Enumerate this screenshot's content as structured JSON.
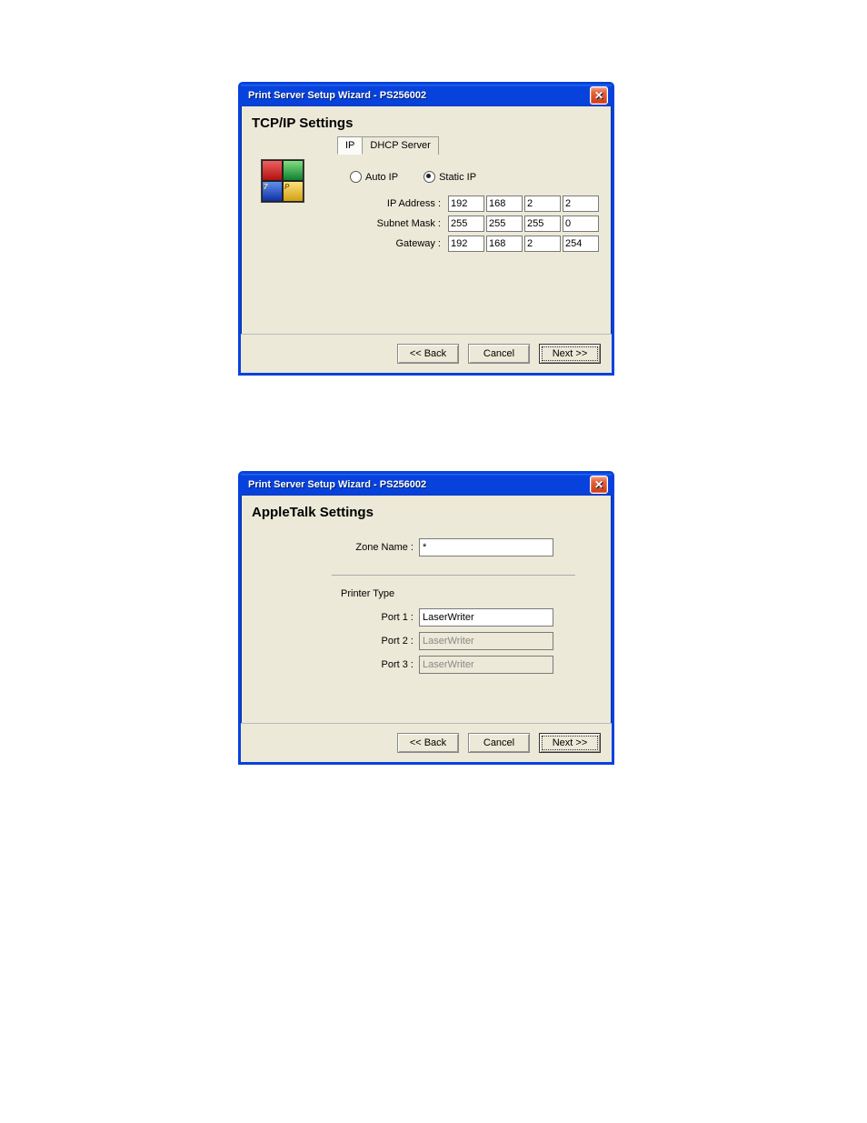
{
  "window1": {
    "title": "Print Server Setup Wizard - PS256002",
    "section_title": "TCP/IP Settings",
    "tabs": {
      "ip": "IP",
      "dhcp": "DHCP Server"
    },
    "radios": {
      "auto": "Auto IP",
      "static": "Static IP"
    },
    "fields": {
      "ip_label": "IP Address :",
      "subnet_label": "Subnet Mask :",
      "gateway_label": "Gateway :",
      "ip": [
        "192",
        "168",
        "2",
        "2"
      ],
      "subnet": [
        "255",
        "255",
        "255",
        "0"
      ],
      "gateway": [
        "192",
        "168",
        "2",
        "254"
      ]
    },
    "logo": {
      "blue_txt": "7",
      "yellow_txt": "P"
    },
    "buttons": {
      "back": "<< Back",
      "cancel": "Cancel",
      "next": "Next >>"
    }
  },
  "window2": {
    "title": "Print Server Setup Wizard - PS256002",
    "section_title": "AppleTalk Settings",
    "zone_label": "Zone Name :",
    "zone_value": "*",
    "printer_type_label": "Printer Type",
    "ports": {
      "p1_label": "Port 1 :",
      "p1_value": "LaserWriter",
      "p2_label": "Port 2 :",
      "p2_value": "LaserWriter",
      "p3_label": "Port 3 :",
      "p3_value": "LaserWriter"
    },
    "buttons": {
      "back": "<< Back",
      "cancel": "Cancel",
      "next": "Next >>"
    }
  }
}
